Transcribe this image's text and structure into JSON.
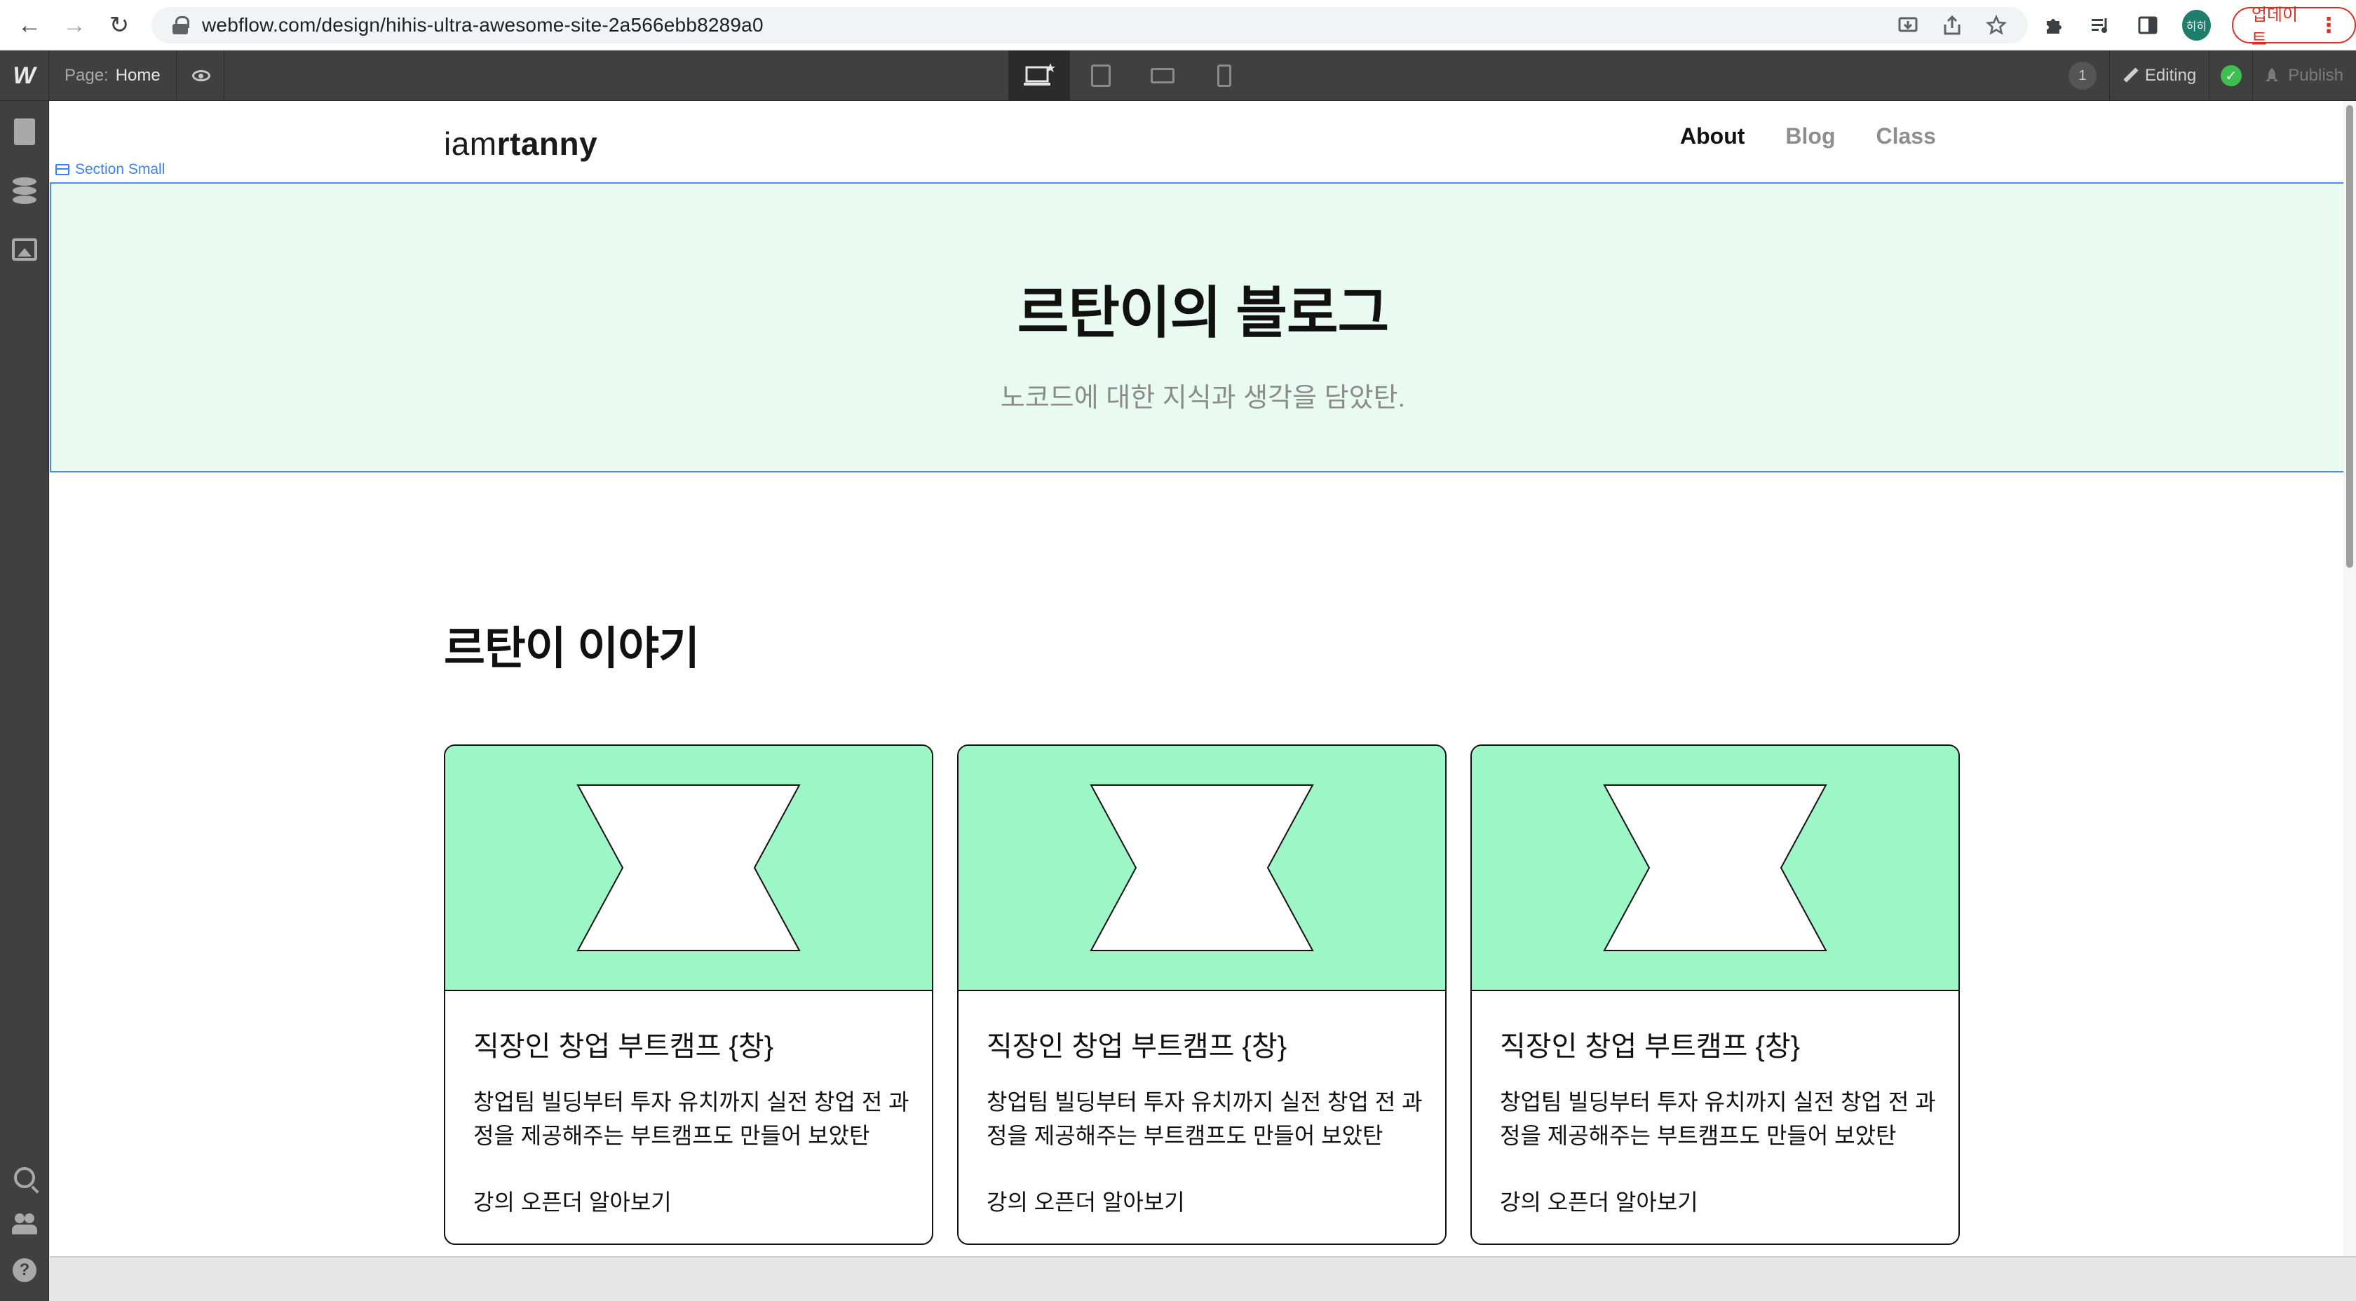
{
  "browser": {
    "url": "webflow.com/design/hihis-ultra-awesome-site-2a566ebb8289a0",
    "profile_initials": "히히",
    "update_label": "업데이트",
    "back_glyph": "←",
    "forward_glyph": "→",
    "reload_glyph": "↻",
    "menu_glyph": "⋮"
  },
  "webflow": {
    "logo": "W",
    "page_label": "Page:",
    "page_name": "Home",
    "notification_count": "1",
    "editing_label": "Editing",
    "publish_label": "Publish",
    "status_color": "#3fbf4f",
    "selected_element_label": "Section Small"
  },
  "site": {
    "brand_light": "iam",
    "brand_bold": "rtanny",
    "nav": [
      {
        "label": "About",
        "current": true
      },
      {
        "label": "Blog",
        "current": false
      },
      {
        "label": "Class",
        "current": false
      }
    ],
    "hero": {
      "title": "르탄이의 블로그",
      "subtitle": "노코드에 대한 지식과 생각을 담았탄.",
      "background": "#e9faf2"
    },
    "section_title": "르탄이 이야기",
    "card_accent": "#9cf6c6",
    "cards": [
      {
        "title": "직장인 창업 부트캠프 {창}",
        "description": "창업팀 빌딩부터 투자 유치까지 실전 창업 전 과정을 제공해주는 부트캠프도 만들어 보았탄",
        "link": "강의 오픈더 알아보기"
      },
      {
        "title": "직장인 창업 부트캠프 {창}",
        "description": "창업팀 빌딩부터 투자 유치까지 실전 창업 전 과정을 제공해주는 부트캠프도 만들어 보았탄",
        "link": "강의 오픈더 알아보기"
      },
      {
        "title": "직장인 창업 부트캠프 {창}",
        "description": "창업팀 빌딩부터 투자 유치까지 실전 창업 전 과정을 제공해주는 부트캠프도 만들어 보았탄",
        "link": "강의 오픈더 알아보기"
      }
    ]
  }
}
